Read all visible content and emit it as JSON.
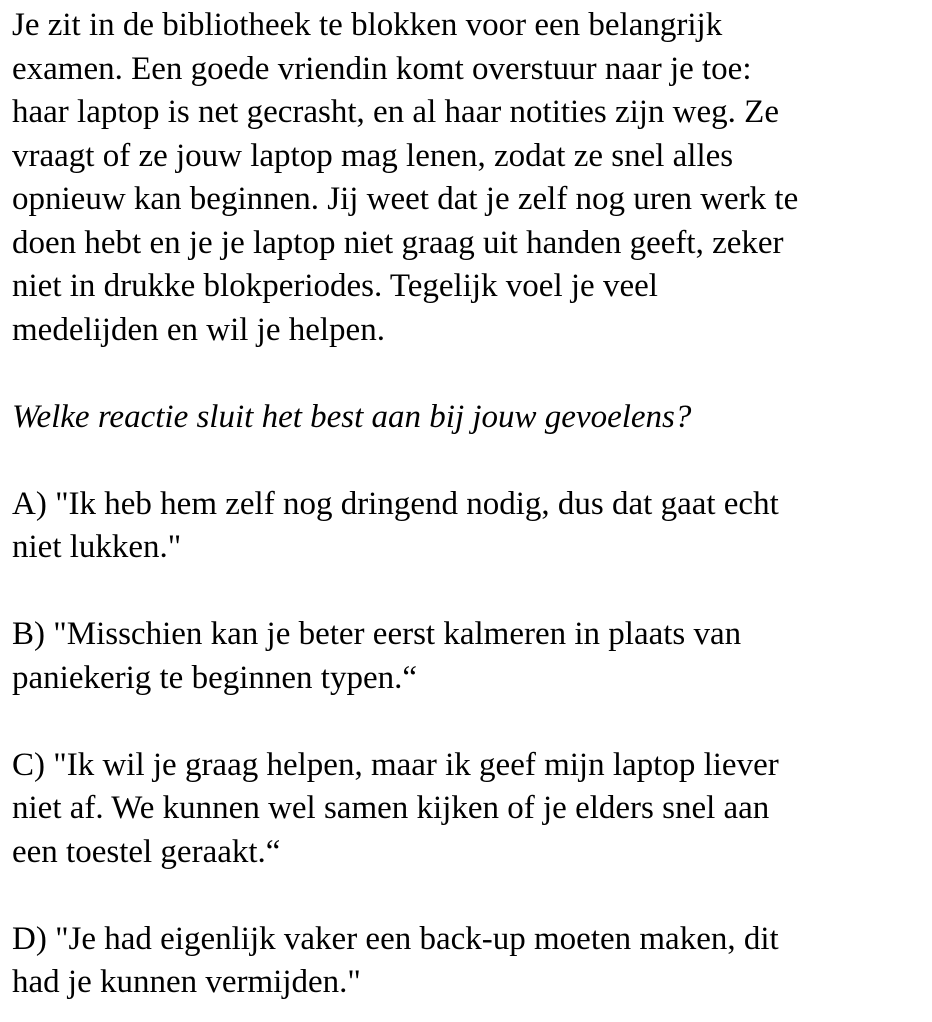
{
  "scenario": {
    "text": "Je zit in de bibliotheek te blokken voor een belangrijk\nexamen. Een goede vriendin komt overstuur naar je toe:\nhaar laptop is net gecrasht, en al haar notities zijn weg. Ze\nvraagt of ze jouw laptop mag lenen, zodat ze snel alles\nopnieuw kan beginnen. Jij weet dat je zelf nog uren werk te\ndoen hebt en je je laptop niet graag uit handen geeft, zeker\nniet in drukke blokperiodes. Tegelijk voel je veel\nmedelijden en wil je helpen."
  },
  "question": "Welke reactie sluit het best aan bij jouw gevoelens?",
  "options": [
    {
      "text": "A) \"Ik heb hem zelf nog dringend nodig, dus dat gaat echt\nniet lukken.\""
    },
    {
      "text": "B) \"Misschien kan je beter eerst kalmeren in plaats van\npaniekerig te beginnen typen.“"
    },
    {
      "text": "C) \"Ik wil je graag helpen, maar ik geef mijn laptop liever\nniet af. We kunnen wel samen kijken of je elders snel aan\neen toestel geraakt.“"
    },
    {
      "text": "D) \"Je had eigenlijk vaker een back-up moeten maken, dit\nhad je kunnen vermijden.\""
    }
  ]
}
